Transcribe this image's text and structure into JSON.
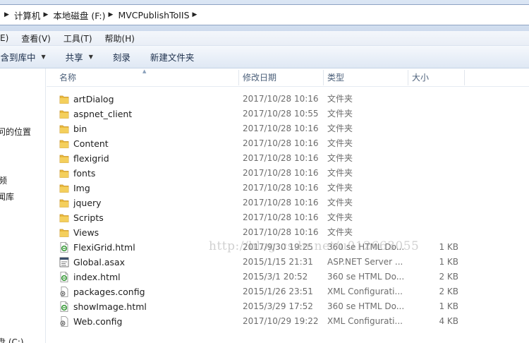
{
  "breadcrumb": {
    "items": [
      "计算机",
      "本地磁盘 (F:)",
      "MVCPublishToIIS"
    ]
  },
  "menu": {
    "items": [
      "E)",
      "查看(V)",
      "工具(T)",
      "帮助(H)"
    ]
  },
  "toolbar": {
    "include_label": "包含到库中",
    "share_label": "共享",
    "burn_label": "刻录",
    "new_folder_label": "新建文件夹"
  },
  "nav": {
    "items": [
      "问的位置",
      "频",
      "闻库",
      "盘 (C:)"
    ]
  },
  "columns": {
    "name": "名称",
    "date": "修改日期",
    "type": "类型",
    "size": "大小"
  },
  "files": [
    {
      "name": "artDialog",
      "date": "2017/10/28 10:16",
      "type": "文件夹",
      "size": "",
      "icon": "folder-icon"
    },
    {
      "name": "aspnet_client",
      "date": "2017/10/28 10:55",
      "type": "文件夹",
      "size": "",
      "icon": "folder-icon"
    },
    {
      "name": "bin",
      "date": "2017/10/28 10:16",
      "type": "文件夹",
      "size": "",
      "icon": "folder-icon"
    },
    {
      "name": "Content",
      "date": "2017/10/28 10:16",
      "type": "文件夹",
      "size": "",
      "icon": "folder-icon"
    },
    {
      "name": "flexigrid",
      "date": "2017/10/28 10:16",
      "type": "文件夹",
      "size": "",
      "icon": "folder-icon"
    },
    {
      "name": "fonts",
      "date": "2017/10/28 10:16",
      "type": "文件夹",
      "size": "",
      "icon": "folder-icon"
    },
    {
      "name": "Img",
      "date": "2017/10/28 10:16",
      "type": "文件夹",
      "size": "",
      "icon": "folder-icon"
    },
    {
      "name": "jquery",
      "date": "2017/10/28 10:16",
      "type": "文件夹",
      "size": "",
      "icon": "folder-icon"
    },
    {
      "name": "Scripts",
      "date": "2017/10/28 10:16",
      "type": "文件夹",
      "size": "",
      "icon": "folder-icon"
    },
    {
      "name": "Views",
      "date": "2017/10/28 10:16",
      "type": "文件夹",
      "size": "",
      "icon": "folder-icon"
    },
    {
      "name": "FlexiGrid.html",
      "date": "2017/9/30 19:25",
      "type": "360 se HTML Do...",
      "size": "1 KB",
      "icon": "html-file-icon"
    },
    {
      "name": "Global.asax",
      "date": "2015/1/15 21:31",
      "type": "ASP.NET Server ...",
      "size": "1 KB",
      "icon": "asax-file-icon"
    },
    {
      "name": "index.html",
      "date": "2015/3/1 20:52",
      "type": "360 se HTML Do...",
      "size": "2 KB",
      "icon": "html-file-icon"
    },
    {
      "name": "packages.config",
      "date": "2015/1/26 23:51",
      "type": "XML Configurati...",
      "size": "2 KB",
      "icon": "config-file-icon"
    },
    {
      "name": "showImage.html",
      "date": "2015/3/29 17:52",
      "type": "360 se HTML Do...",
      "size": "1 KB",
      "icon": "html-file-icon"
    },
    {
      "name": "Web.config",
      "date": "2017/10/29 19:22",
      "type": "XML Configurati...",
      "size": "4 KB",
      "icon": "config-file-icon"
    }
  ],
  "watermark": "http://blog.csdn.net/u012663055",
  "colors": {
    "folder": "#e9b93c",
    "html_icon": "#3a9a3a",
    "header_text": "#4c607a",
    "secondary_text": "#6d6d6d"
  }
}
